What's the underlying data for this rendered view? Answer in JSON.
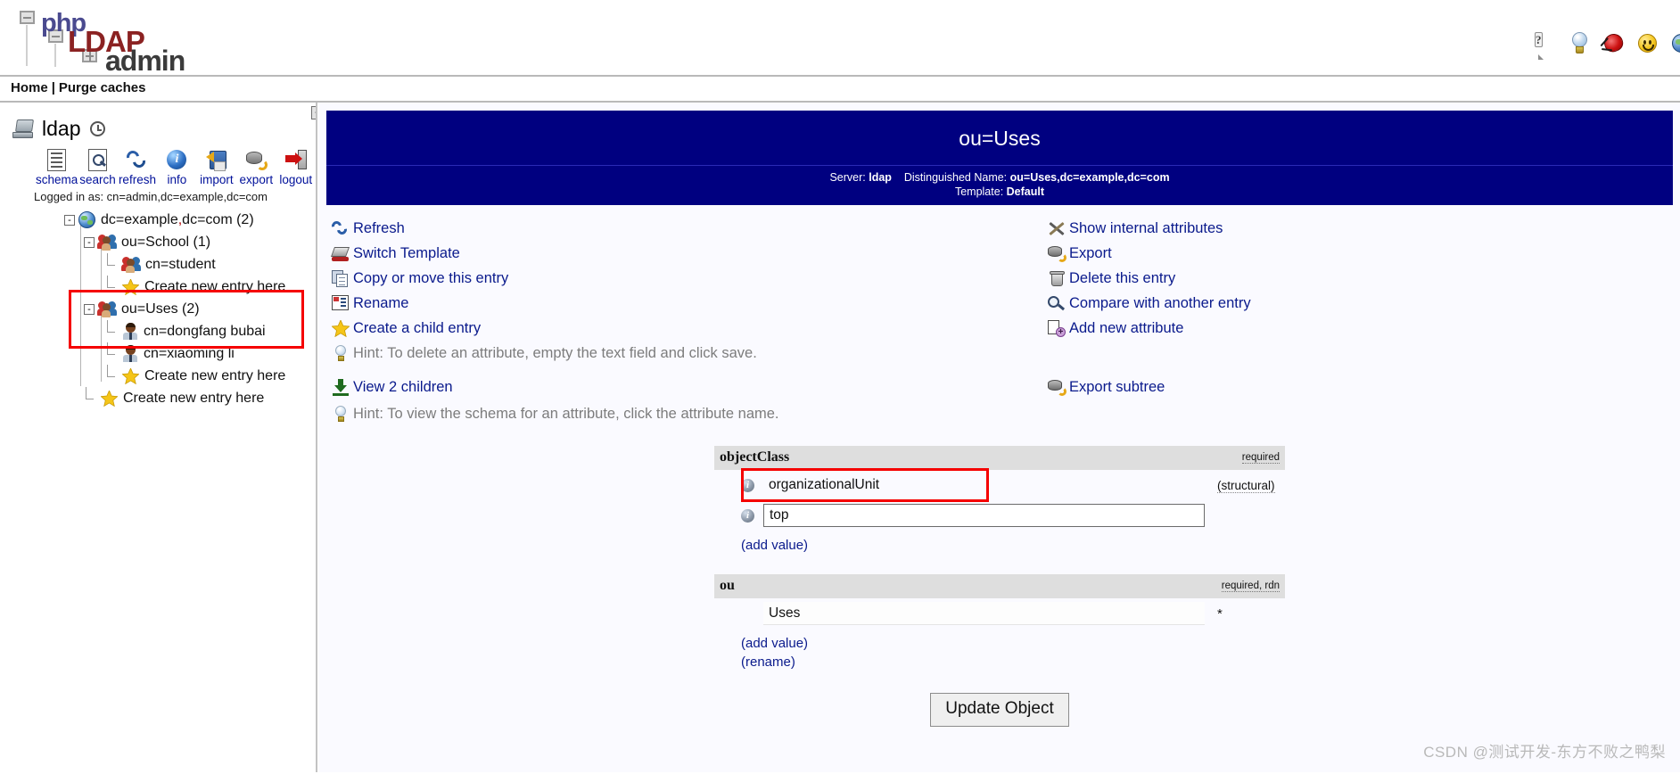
{
  "app": {
    "logo": {
      "php": "php",
      "ldap": "LDAP",
      "admin": "admin"
    }
  },
  "header_icons": [
    {
      "name": "help-icon",
      "glyph": "?"
    },
    {
      "name": "hint-bulb-icon",
      "glyph": ""
    },
    {
      "name": "report-bug-icon",
      "glyph": ""
    },
    {
      "name": "feedback-smiley-icon",
      "glyph": ""
    },
    {
      "name": "language-globe-icon",
      "glyph": ""
    }
  ],
  "navbar": {
    "home": "Home",
    "separator": "|",
    "purge": "Purge caches"
  },
  "sidebar": {
    "expand_button": "+",
    "server_name": "ldap",
    "tools": [
      {
        "name": "schema",
        "label": "schema"
      },
      {
        "name": "search",
        "label": "search"
      },
      {
        "name": "refresh",
        "label": "refresh"
      },
      {
        "name": "info",
        "label": "info"
      },
      {
        "name": "import",
        "label": "import"
      },
      {
        "name": "export",
        "label": "export"
      },
      {
        "name": "logout",
        "label": "logout"
      }
    ],
    "logged_in_as": "Logged in as: cn=admin,dc=example,dc=com",
    "tree": [
      {
        "label_pre": "dc=example",
        "comma": ",",
        "label_post": "dc=com (2)",
        "icon": "domain-icon",
        "expander": "-",
        "level": 0
      },
      {
        "label": "ou=School (1)",
        "icon": "group-icon",
        "expander": "-",
        "level": 1
      },
      {
        "label": "cn=student",
        "icon": "group-icon",
        "expander": "",
        "level": 2
      },
      {
        "label": "Create new entry here",
        "icon": "star-icon",
        "expander": "",
        "level": 2
      },
      {
        "label": "ou=Uses (2)",
        "icon": "group-icon",
        "expander": "-",
        "level": 1
      },
      {
        "label": "cn=dongfang bubai",
        "icon": "user-icon",
        "expander": "",
        "level": 2
      },
      {
        "label": "cn=xiaoming li",
        "icon": "user-icon",
        "expander": "",
        "level": 2
      },
      {
        "label": "Create new entry here",
        "icon": "star-icon",
        "expander": "",
        "level": 2
      },
      {
        "label": "Create new entry here",
        "icon": "star-icon",
        "expander": "",
        "level": 1
      }
    ]
  },
  "entry": {
    "title": "ou=Uses",
    "server_label": "Server:",
    "server_value": "ldap",
    "dn_label": "Distinguished Name:",
    "dn_value": "ou=Uses,dc=example,dc=com",
    "template_label": "Template:",
    "template_value": "Default"
  },
  "actions_left": [
    {
      "name": "refresh",
      "label": "Refresh",
      "icon": "refresh-icon",
      "type": "link"
    },
    {
      "name": "switch-template",
      "label": "Switch Template",
      "icon": "template-icon",
      "type": "link"
    },
    {
      "name": "copy-move",
      "label": "Copy or move this entry",
      "icon": "copy-icon",
      "type": "link"
    },
    {
      "name": "rename",
      "label": "Rename",
      "icon": "rename-icon",
      "type": "link"
    },
    {
      "name": "create-child",
      "label": "Create a child entry",
      "icon": "star-icon",
      "type": "link"
    },
    {
      "name": "hint-delete",
      "label": "Hint: To delete an attribute, empty the text field and click save.",
      "icon": "bulb-icon",
      "type": "hint"
    },
    {
      "name": "view-children",
      "label": "View 2 children",
      "icon": "download-icon",
      "type": "link"
    }
  ],
  "actions_right": [
    {
      "name": "show-internal-attributes",
      "label": "Show internal attributes",
      "icon": "tools-icon",
      "type": "link"
    },
    {
      "name": "export",
      "label": "Export",
      "icon": "export-icon",
      "type": "link"
    },
    {
      "name": "delete-entry",
      "label": "Delete this entry",
      "icon": "trash-icon",
      "type": "link"
    },
    {
      "name": "compare-entry",
      "label": "Compare with another entry",
      "icon": "compare-icon",
      "type": "link"
    },
    {
      "name": "add-new-attribute",
      "label": "Add new attribute",
      "icon": "add-attribute-icon",
      "type": "link"
    },
    {
      "name": "export-subtree",
      "label": "Export subtree",
      "icon": "export-icon",
      "type": "link"
    }
  ],
  "hint_schema": "Hint: To view the schema for an attribute, click the attribute name.",
  "attributes": [
    {
      "name": "objectClass",
      "flags": "required",
      "values": [
        {
          "value": "organizationalUnit",
          "editable": false,
          "side": "(structural)",
          "highlighted": true
        },
        {
          "value": "top",
          "editable": true,
          "side": ""
        }
      ],
      "links": [
        "(add value)"
      ]
    },
    {
      "name": "ou",
      "flags": "required, rdn",
      "values": [
        {
          "value": "Uses",
          "editable": true,
          "flat": true,
          "side": "*"
        }
      ],
      "links": [
        "(add value)",
        "(rename)"
      ]
    }
  ],
  "update_button": "Update Object",
  "watermark": "CSDN @测试开发-东方不败之鸭梨",
  "colors": {
    "header_blue": "#000080",
    "link_blue": "#0a1a8c",
    "highlight_red": "#f50000",
    "attr_header_gray": "#dedede"
  }
}
